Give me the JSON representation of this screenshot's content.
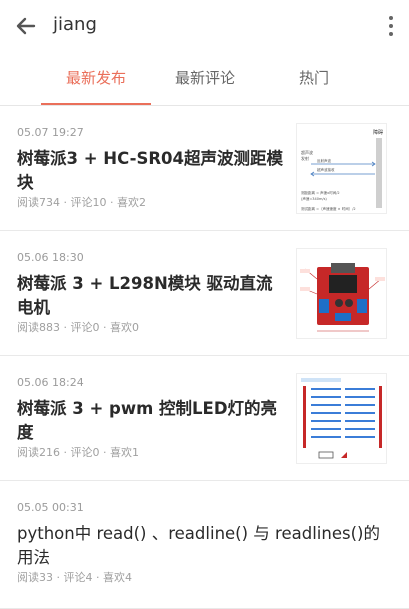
{
  "header": {
    "back_icon": "arrow-left-icon",
    "query": "jiang",
    "more_icon": "more-vert-icon"
  },
  "tabs": [
    {
      "label": "最新发布",
      "active": true
    },
    {
      "label": "最新评论",
      "active": false
    },
    {
      "label": "热门",
      "active": false
    }
  ],
  "accent_color": "#ea6f5a",
  "articles": [
    {
      "time": "05.07 19:27",
      "title": "树莓派3 + HC-SR04超声波测距模块",
      "meta": "阅读734 · 评论10 · 喜欢2",
      "thumb": {
        "label_right": "障碍",
        "labels": [
          "超声波",
          "发射",
          "反射声波",
          "超声波接收",
          "测距距离 = 声速x时间/2",
          "(声速=340m/s)"
        ],
        "formula": "测试距离 =（声速速度 × 时间）/2"
      }
    },
    {
      "time": "05.06 18:30",
      "title": "树莓派 3 + L298N模块 驱动直流电机",
      "meta": "阅读883 · 评论0 · 喜欢0"
    },
    {
      "time": "05.06 18:24",
      "title": "树莓派 3 + pwm 控制LED灯的亮度",
      "meta": "阅读216 · 评论0 · 喜欢1"
    },
    {
      "time": "05.05 00:31",
      "title": "python中 read() 、readline() 与 readlines()的用法",
      "meta": "阅读33 · 评论4 · 喜欢4"
    }
  ]
}
